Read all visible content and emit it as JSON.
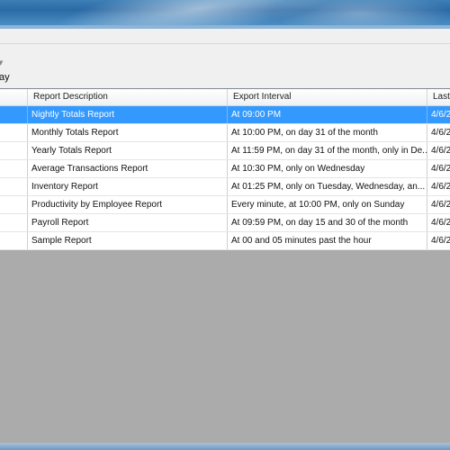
{
  "toolbar": {
    "label": "ay"
  },
  "grid": {
    "columns": [
      "",
      "Report Description",
      "Export Interval",
      "Last"
    ],
    "rows": [
      {
        "description": "Nightly Totals Report",
        "interval": "At 09:00 PM",
        "last": "4/6/2",
        "selected": true
      },
      {
        "description": "Monthly Totals Report",
        "interval": "At 10:00 PM, on day 31 of the month",
        "last": "4/6/2",
        "selected": false
      },
      {
        "description": "Yearly Totals Report",
        "interval": "At 11:59 PM, on day 31 of the month, only in De...",
        "last": "4/6/2",
        "selected": false
      },
      {
        "description": "Average Transactions Report",
        "interval": "At 10:30 PM, only on Wednesday",
        "last": "4/6/2",
        "selected": false
      },
      {
        "description": "Inventory Report",
        "interval": "At 01:25 PM, only on Tuesday, Wednesday, an...",
        "last": "4/6/2",
        "selected": false
      },
      {
        "description": "Productivity by Employee Report",
        "interval": "Every minute, at 10:00 PM, only on Sunday",
        "last": "4/6/2",
        "selected": false
      },
      {
        "description": "Payroll Report",
        "interval": "At 09:59 PM, on day 15 and 30 of the month",
        "last": "4/6/2",
        "selected": false
      },
      {
        "description": "Sample Report",
        "interval": "At 00 and 05 minutes past the hour",
        "last": "4/6/2",
        "selected": false
      }
    ]
  },
  "colors": {
    "selection": "#3399ff",
    "empty_area": "#ababab",
    "title_bar": "#2c6aa6"
  }
}
